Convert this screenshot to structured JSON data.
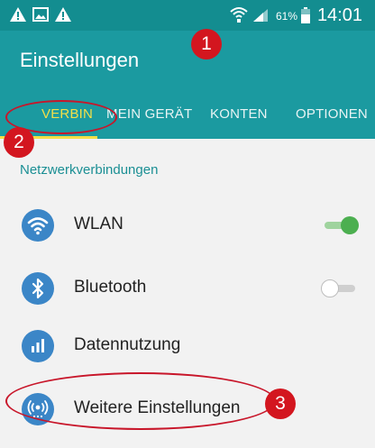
{
  "colors": {
    "header": "#1b9aa0",
    "statusbar": "#138d90",
    "accent": "#f4df47",
    "section": "#1b8f94",
    "icon": "#3b86c7",
    "marker": "#d3161f"
  },
  "statusbar": {
    "left_icons": [
      "warning-icon",
      "image-icon",
      "warning-icon"
    ],
    "right_icons": [
      "wifi-icon",
      "signal-icon",
      "battery-icon"
    ],
    "battery": "61%",
    "time": "14:01"
  },
  "appbar": {
    "title": "Einstellungen"
  },
  "tabs": [
    {
      "label": "VERBIN",
      "active": true
    },
    {
      "label": "MEIN GERÄT",
      "active": false
    },
    {
      "label": "KONTEN",
      "active": false
    },
    {
      "label": "OPTIONEN",
      "active": false
    }
  ],
  "section": {
    "title": "Netzwerkverbindungen"
  },
  "items": [
    {
      "label": "WLAN",
      "icon": "wifi-icon",
      "toggle": "on"
    },
    {
      "label": "Bluetooth",
      "icon": "bluetooth-icon",
      "toggle": "off"
    },
    {
      "label": "Datennutzung",
      "icon": "data-usage-icon"
    },
    {
      "label": "Weitere Einstellungen",
      "icon": "hotspot-icon"
    }
  ],
  "markers": [
    "1",
    "2",
    "3"
  ]
}
